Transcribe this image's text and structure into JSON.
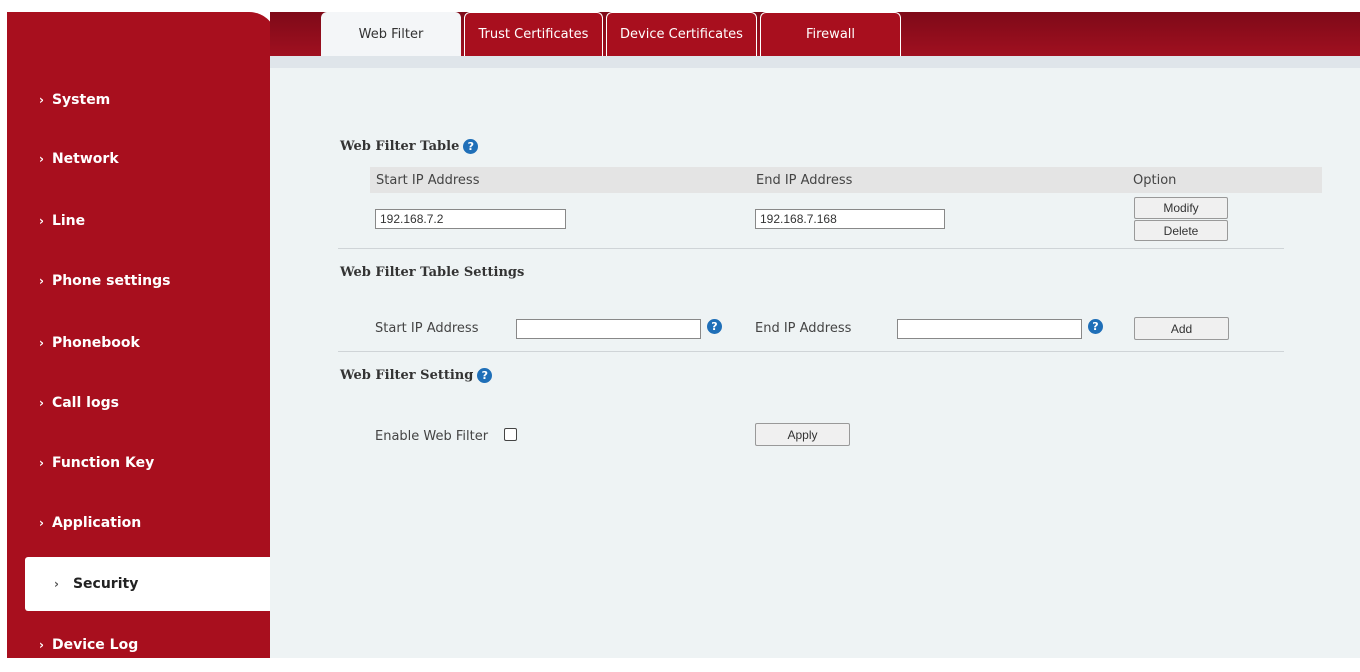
{
  "tabs": [
    {
      "label": "Web Filter",
      "active": true
    },
    {
      "label": "Trust Certificates",
      "active": false
    },
    {
      "label": "Device Certificates",
      "active": false
    },
    {
      "label": "Firewall",
      "active": false
    }
  ],
  "sidebar": {
    "items": [
      {
        "label": "System"
      },
      {
        "label": "Network"
      },
      {
        "label": "Line"
      },
      {
        "label": "Phone settings"
      },
      {
        "label": "Phonebook"
      },
      {
        "label": "Call logs"
      },
      {
        "label": "Function Key"
      },
      {
        "label": "Application"
      },
      {
        "label": "Security",
        "active": true
      },
      {
        "label": "Device Log"
      }
    ],
    "chevron": "›"
  },
  "web_filter_table": {
    "title": "Web Filter Table",
    "columns": [
      "Start IP Address",
      "End IP Address",
      "Option"
    ],
    "rows": [
      {
        "start_ip": "192.168.7.2",
        "end_ip": "192.168.7.168",
        "modify_label": "Modify",
        "delete_label": "Delete"
      }
    ]
  },
  "web_filter_table_settings": {
    "title": "Web Filter Table Settings",
    "start_ip_label": "Start IP Address",
    "start_ip_value": "",
    "end_ip_label": "End IP Address",
    "end_ip_value": "",
    "add_label": "Add"
  },
  "web_filter_setting": {
    "title": "Web Filter Setting",
    "enable_label": "Enable Web Filter",
    "enabled": false,
    "apply_label": "Apply"
  },
  "help_glyph": "?",
  "colors": {
    "brand_red": "#a80f1e",
    "help_blue": "#1f6fb8",
    "content_bg": "#eef3f4"
  }
}
